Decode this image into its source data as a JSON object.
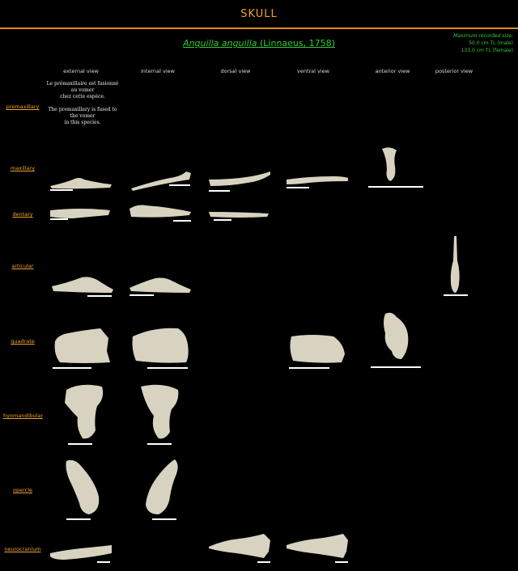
{
  "page": {
    "title": "SKULL"
  },
  "species": {
    "genus_species": "Anguilla anguilla",
    "authority": "(Linnaeus, 1758)"
  },
  "max_size": {
    "heading": "Maximum recorded size:",
    "male": "50.0 cm TL (male)",
    "female": "133.0 cm TL (female)"
  },
  "columns": [
    "external view",
    "internal view",
    "dorsal view",
    "ventral view",
    "anterior view",
    "posterior view"
  ],
  "rows": [
    "premaxillary",
    "maxillary",
    "dentary",
    "articular",
    "quadrate",
    "hyomandibular",
    "opercle",
    "neurocranium"
  ],
  "note": {
    "fr_line1": "Le prémaxillaire est fusionné",
    "fr_line2": "au vomer",
    "fr_line3": "chez cette espèce.",
    "en_line1": "The premaxillary is fused to",
    "en_line2": "the vomer",
    "en_line3": "in this species."
  },
  "colors": {
    "title": "#f0a030",
    "rule": "#e08a20",
    "species": "#33cc33",
    "bone": "#d8d2c0"
  }
}
